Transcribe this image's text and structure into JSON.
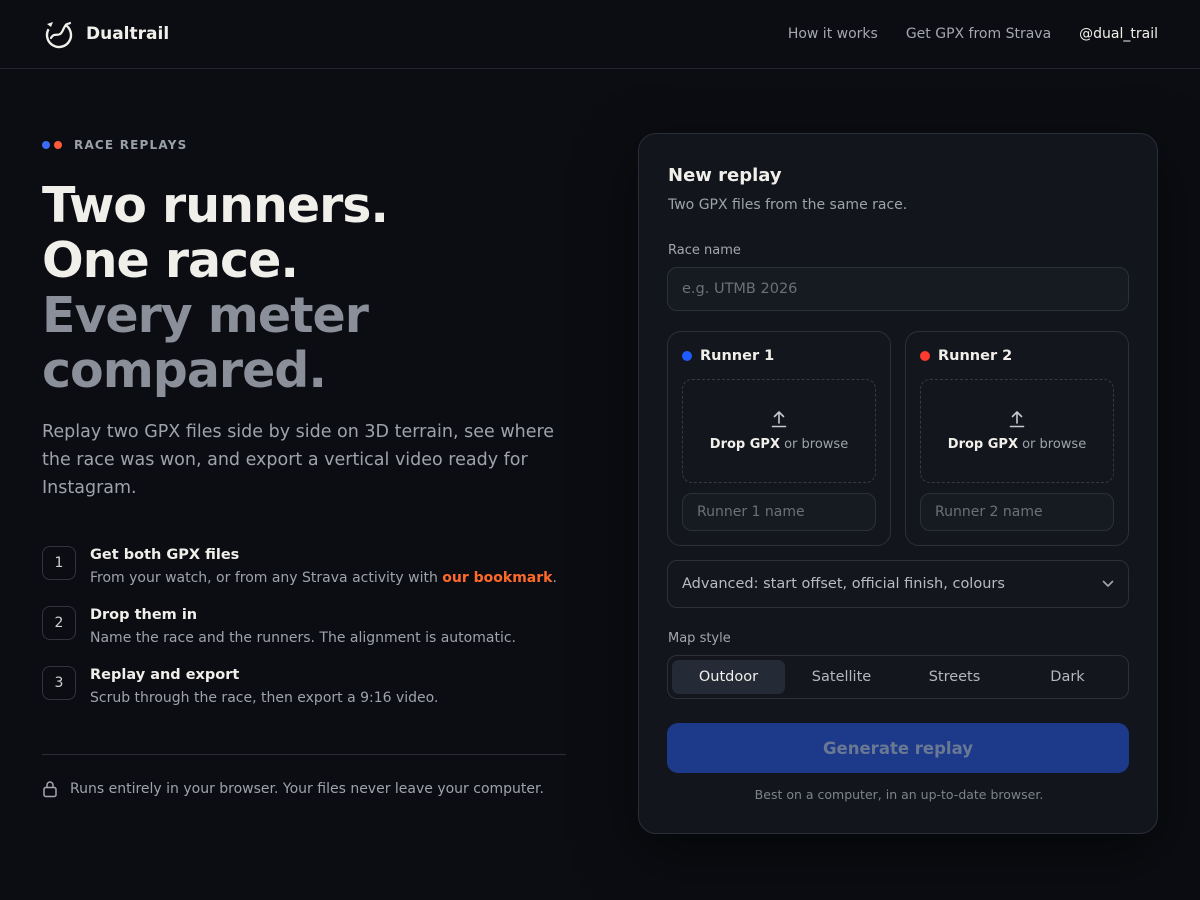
{
  "header": {
    "brand_name": "Dualtrail",
    "logo_icon": "ring-trail-logo-icon",
    "nav": [
      {
        "label": "How it works"
      },
      {
        "label": "Get GPX from Strava"
      },
      {
        "label": "@dual_trail"
      }
    ]
  },
  "hero": {
    "eyebrow": "RACE REPLAYS",
    "eyebrow_dots": [
      "#3b6cf6",
      "#ff5a3c"
    ],
    "headline": {
      "line1": "Two runners.",
      "line2": "One race.",
      "line3": "Every meter",
      "line4": "compared."
    },
    "lede": "Replay two GPX files side by side on 3D terrain, see where the race was won, and export a vertical video ready for Instagram."
  },
  "steps": [
    {
      "num": "1",
      "title": "Get both GPX files",
      "desc_before": "From your watch, or from any Strava activity with ",
      "link": "our bookmark",
      "desc_after": "."
    },
    {
      "num": "2",
      "title": "Drop them in",
      "desc": "Name the race and the runners. The alignment is automatic."
    },
    {
      "num": "3",
      "title": "Replay and export",
      "desc": "Scrub through the race, then export a 9:16 video."
    }
  ],
  "privacy": {
    "icon": "lock-icon",
    "text": "Runs entirely in your browser. Your files never leave your computer."
  },
  "card": {
    "title": "New replay",
    "subtitle": "Two GPX files from the same race.",
    "race_name_label": "Race name",
    "race_name_placeholder": "e.g. UTMB 2026",
    "runners": [
      {
        "label": "Runner 1",
        "color": "#1f5cff",
        "drop_strong": "Drop GPX",
        "drop_rest": " or browse",
        "name_placeholder": "Runner 1 name"
      },
      {
        "label": "Runner 2",
        "color": "#ff3b30",
        "drop_strong": "Drop GPX",
        "drop_rest": " or browse",
        "name_placeholder": "Runner 2 name"
      }
    ],
    "advanced_label": "Advanced: start offset, official finish, colours",
    "map_style_label": "Map style",
    "map_styles": [
      "Outdoor",
      "Satellite",
      "Streets",
      "Dark"
    ],
    "map_style_selected": "Outdoor",
    "generate_label": "Generate replay",
    "footnote": "Best on a computer, in an up-to-date browser."
  },
  "colors": {
    "background": "#0b0d12",
    "card": "#12151b",
    "accent_link": "#ff6a2b",
    "generate_button": "#1d3a8a"
  }
}
